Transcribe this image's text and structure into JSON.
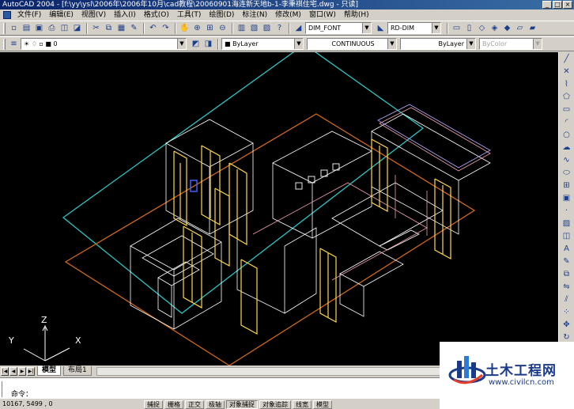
{
  "window": {
    "title": "AutoCAD 2004 - [f:\\yy\\ysl\\2006年\\2006年10月\\cad教程\\20060901海连新天地b-1-李秉祺住宅.dwg - 只读]",
    "buttons": [
      "_",
      "□",
      "×"
    ]
  },
  "menu": [
    "文件(F)",
    "编辑(E)",
    "视图(V)",
    "插入(I)",
    "格式(O)",
    "工具(T)",
    "绘图(D)",
    "标注(N)",
    "修改(M)",
    "窗口(W)",
    "帮助(H)"
  ],
  "toolbar1": {
    "icons_left": [
      "new-icon",
      "open-icon",
      "save-icon",
      "print-icon",
      "preview-icon",
      "publish-icon",
      "cut-icon",
      "copy-icon",
      "paste-icon",
      "matchprop-icon",
      "undo-icon",
      "redo-icon",
      "pan-icon",
      "zoom-realtime-icon",
      "zoom-window-icon",
      "zoom-previous-icon",
      "properties-icon",
      "designcenter-icon",
      "toolpalette-icon",
      "help-icon"
    ],
    "dimstyle": "DIM_FONT",
    "textstyle": "RD-DIM"
  },
  "toolbar2": {
    "layer": "0",
    "color": "ByLayer",
    "linetype": "CONTINUOUS",
    "lineweight": "ByLayer",
    "plotstyle": "ByColor"
  },
  "right_tools": [
    "line-icon",
    "xline-icon",
    "polyline-icon",
    "polygon-icon",
    "rectangle-icon",
    "arc-icon",
    "circle-icon",
    "revcloud-icon",
    "spline-icon",
    "ellipse-icon",
    "insert-icon",
    "block-icon",
    "point-icon",
    "hatch-icon",
    "region-icon",
    "mtext-icon",
    "erase-icon",
    "copy-icon",
    "mirror-icon",
    "offset-icon"
  ],
  "ucs": {
    "x": "X",
    "y": "Y",
    "z": "Z"
  },
  "tabs": [
    {
      "label": "模型",
      "active": true
    },
    {
      "label": "布局1",
      "active": false
    }
  ],
  "command": {
    "prompt": "命令："
  },
  "status": {
    "coords": "10167, 5499 , 0",
    "buttons": [
      "捕捉",
      "栅格",
      "正交",
      "极轴",
      "对象捕捉",
      "对象追踪",
      "线宽",
      "模型"
    ]
  },
  "watermark": {
    "name": "土木工程网",
    "url": "www.civilcn.com"
  },
  "colors": {
    "cyan": "#2ec4c4",
    "orange": "#d2691e",
    "yellow": "#ffd84a",
    "white": "#ffffff",
    "pink": "#f2a0b0",
    "lavender": "#b8a8ff"
  }
}
